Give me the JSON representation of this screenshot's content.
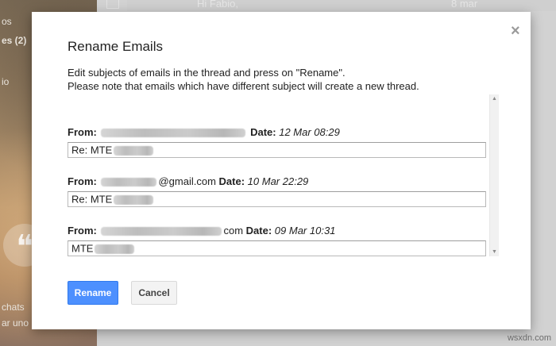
{
  "background": {
    "sidebar_fragments": [
      "os",
      "es (2)",
      "io",
      "chats",
      "ar uno"
    ],
    "email_row_snippet": "Hi Fabio,",
    "email_row_date": "8 mar"
  },
  "dialog": {
    "title": "Rename Emails",
    "close_glyph": "×",
    "description_line1": "Edit subjects of emails in the thread and press on \"Rename\".",
    "description_line2": "Please note that emails which have different subject will create a new thread.",
    "from_label": "From:",
    "date_label": "Date:",
    "emails": [
      {
        "from_suffix": "",
        "date": "12 Mar 08:29",
        "subject": "Re: MTE"
      },
      {
        "from_suffix": "@gmail.com",
        "date": "10 Mar 22:29",
        "subject": "Re: MTE"
      },
      {
        "from_suffix": "com",
        "date": "09 Mar 10:31",
        "subject": "MTE"
      }
    ],
    "rename_label": "Rename",
    "cancel_label": "Cancel"
  },
  "watermark": "wsxdn.com",
  "colors": {
    "primary_button": "#4d90fe",
    "dialog_background": "#ffffff",
    "overlay": "#d2d2d2"
  }
}
